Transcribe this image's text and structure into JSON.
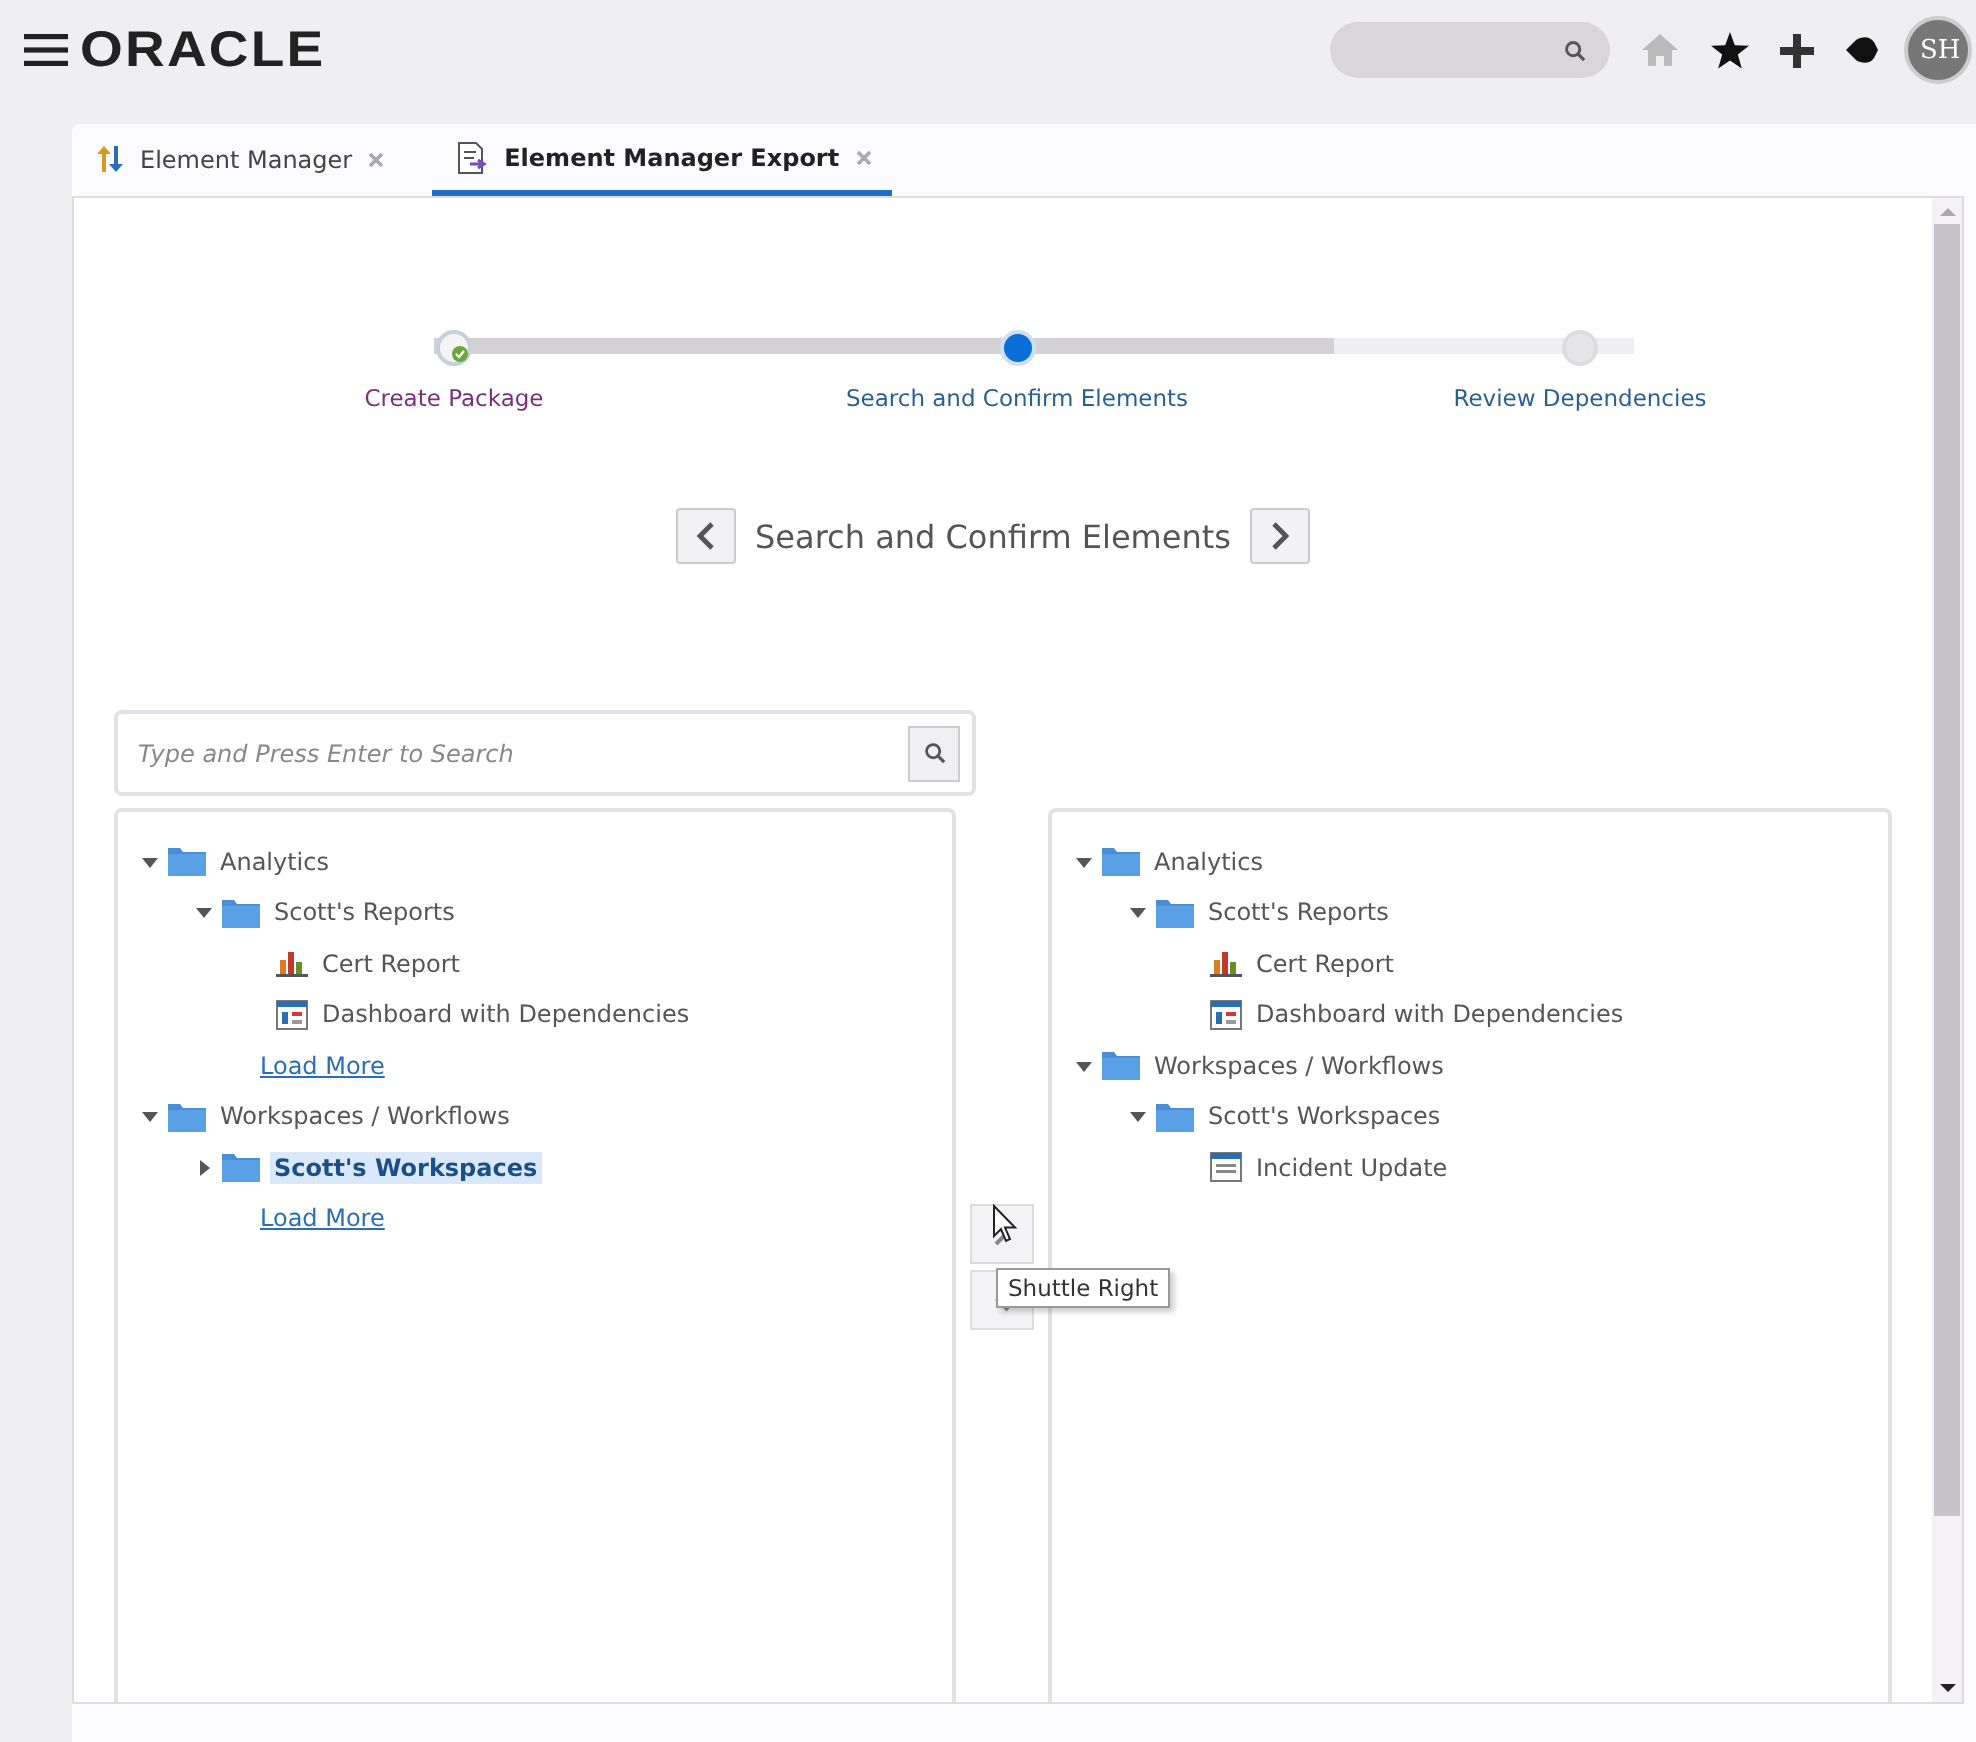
{
  "header": {
    "logo": "ORACLE",
    "avatar": "SH"
  },
  "tabs": [
    {
      "label": "Element Manager",
      "kind": "manager",
      "selected": false
    },
    {
      "label": "Element Manager Export",
      "kind": "export",
      "selected": true
    }
  ],
  "stepper": {
    "level": 0.75,
    "steps": [
      {
        "label": "Create Package",
        "completed": true,
        "selected": false
      },
      {
        "label": "Search and Confirm Elements",
        "completed": false,
        "selected": true
      },
      {
        "label": "Review Dependencies",
        "completed": false,
        "selected": false
      }
    ]
  },
  "step_nav": {
    "title": "Search and Confirm Elements"
  },
  "search": {
    "placeholder": "Type and Press Enter to Search"
  },
  "left_tree": [
    {
      "kind": "folder",
      "label": "Analytics",
      "expanded": true,
      "selected": false,
      "children": [
        {
          "kind": "folder",
          "label": "Scott's Reports",
          "expanded": true,
          "selected": false,
          "children": [
            {
              "kind": "report",
              "label": "Cert Report",
              "selected": false
            },
            {
              "kind": "dashboard",
              "label": "Dashboard with Dependencies",
              "selected": false
            }
          ]
        },
        {
          "kind": "link",
          "label": "Load More"
        }
      ]
    },
    {
      "kind": "folder",
      "label": "Workspaces / Workflows",
      "expanded": true,
      "selected": false,
      "children": [
        {
          "kind": "folder",
          "label": "Scott's Workspaces",
          "expanded": false,
          "selected": true
        },
        {
          "kind": "link",
          "label": "Load More"
        }
      ]
    }
  ],
  "right_tree": [
    {
      "kind": "folder",
      "label": "Analytics",
      "expanded": true,
      "children": [
        {
          "kind": "folder",
          "label": "Scott's Reports",
          "expanded": true,
          "children": [
            {
              "kind": "report",
              "label": "Cert Report"
            },
            {
              "kind": "dashboard",
              "label": "Dashboard with Dependencies"
            }
          ]
        }
      ]
    },
    {
      "kind": "folder",
      "label": "Workspaces / Workflows",
      "expanded": true,
      "children": [
        {
          "kind": "folder",
          "label": "Scott's Workspaces",
          "expanded": true,
          "children": [
            {
              "kind": "workspace",
              "label": "Incident Update"
            }
          ]
        }
      ]
    }
  ],
  "tooltip": "Shuttle Right"
}
